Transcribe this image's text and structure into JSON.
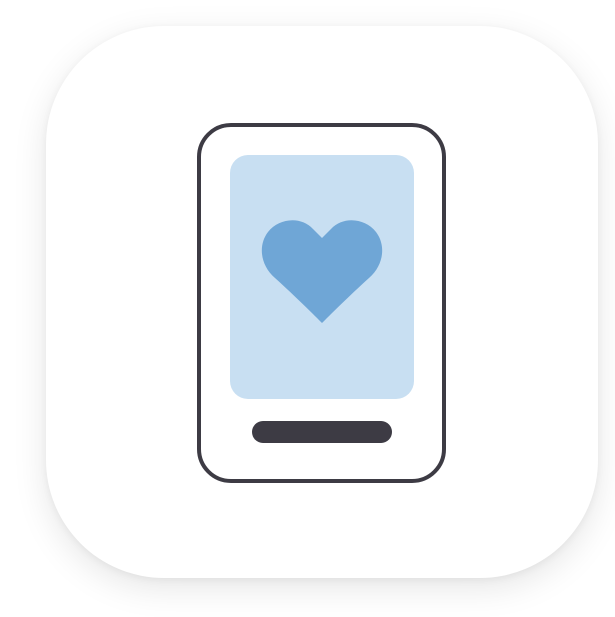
{
  "app_icon": {
    "icon_name": "phone-heart-icon",
    "colors": {
      "tile_background": "#ffffff",
      "device_outline": "#3d3b44",
      "device_fill": "#ffffff",
      "screen_fill": "#c8dff2",
      "heart_fill": "#6fa6d6",
      "home_bar": "#3d3b44"
    }
  }
}
